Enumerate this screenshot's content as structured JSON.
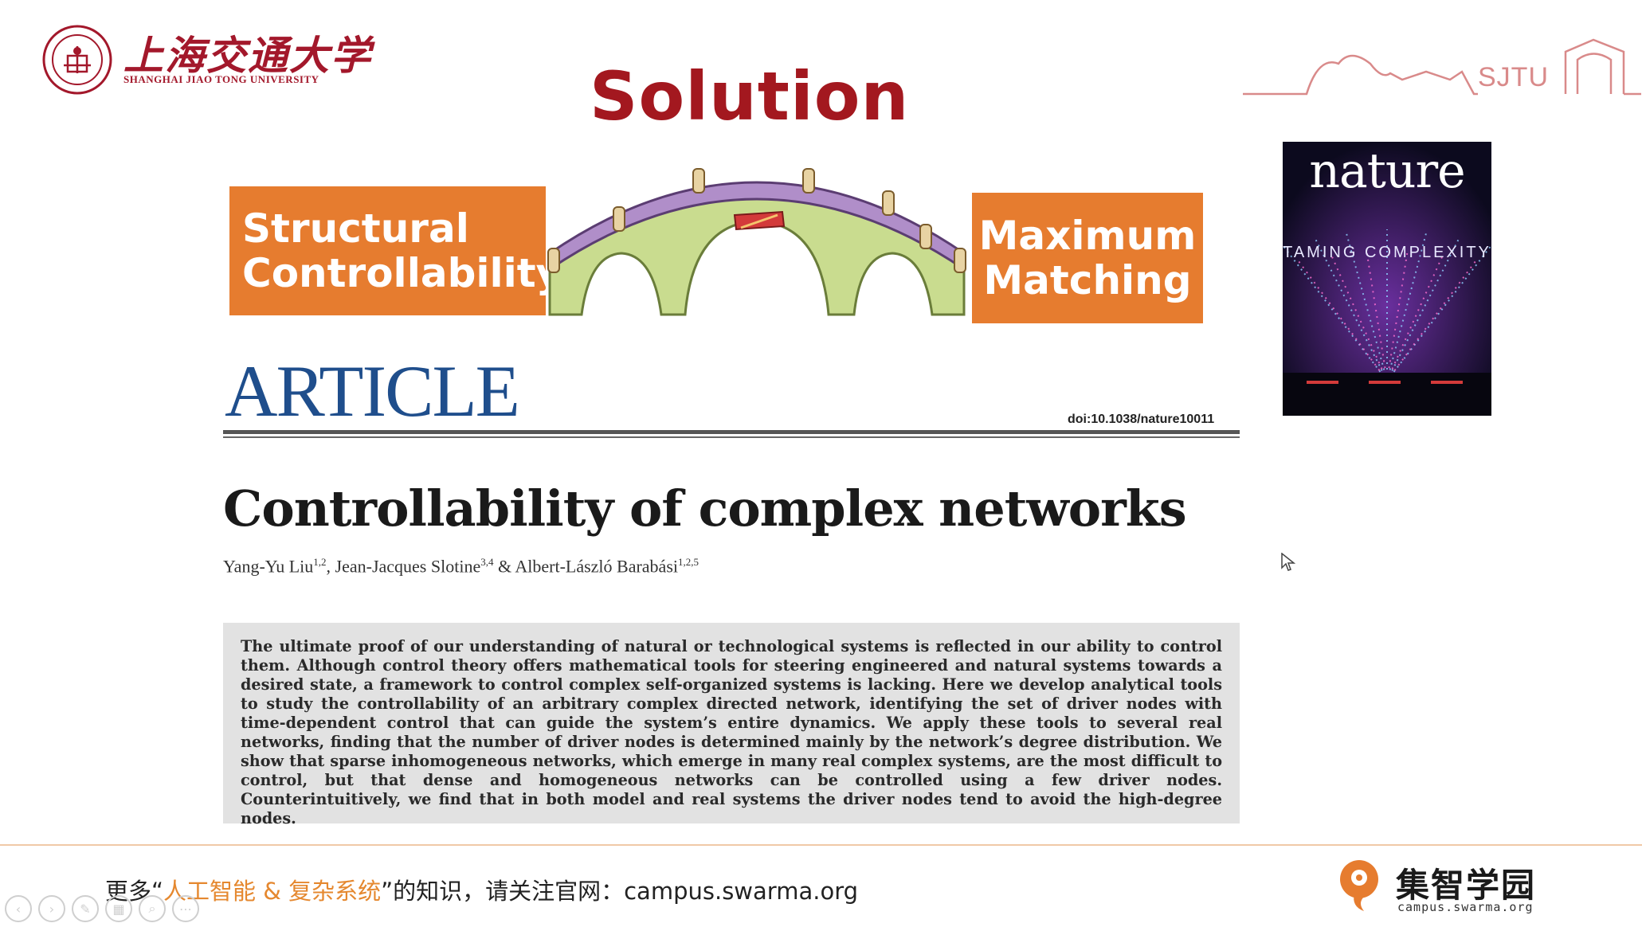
{
  "header": {
    "university_cn": "上海交通大学",
    "university_en": "SHANGHAI JIAO TONG UNIVERSITY",
    "sjtu_mark": "SJTU"
  },
  "slide": {
    "title": "Solution",
    "left_box": [
      "Structural",
      "Controllability"
    ],
    "right_box": [
      "Maximum",
      "Matching"
    ],
    "journal_cover": {
      "title": "nature",
      "subtitle": "TAMING COMPLEXITY"
    },
    "article_label": "ARTICLE",
    "doi": "doi:10.1038/nature10011",
    "paper_title": "Controllability of complex networks",
    "authors": [
      {
        "name": "Yang-Yu Liu",
        "sup": "1,2"
      },
      {
        "name": "Jean-Jacques Slotine",
        "sup": "3,4"
      },
      {
        "name": "Albert-László Barabási",
        "sup": "1,2,5"
      }
    ],
    "abstract": "The ultimate proof of our understanding of natural or technological systems is reflected in our ability to control them. Although control theory offers mathematical tools for steering engineered and natural systems towards a desired state, a framework to control complex self-organized systems is lacking. Here we develop analytical tools to study the controllability of an arbitrary complex directed network, identifying the set of driver nodes with time-dependent control that can guide the system’s entire dynamics. We apply these tools to several real networks, finding that the number of driver nodes is determined mainly by the network’s degree distribution. We show that sparse inhomogeneous networks, which emerge in many real complex systems, are the most difficult to control, but that dense and homogeneous networks can be controlled using a few driver nodes. Counterintuitively, we find that in both model and real systems the driver nodes tend to avoid the high-degree nodes."
  },
  "footer": {
    "text_prefix": "更多“",
    "text_highlight": "人工智能 & 复杂系统",
    "text_suffix": "”的知识，请关注官网：campus.swarma.org",
    "brand_cn": "集智学园",
    "brand_en": "campus.swarma.org"
  },
  "colors": {
    "accent_red": "#a3181f",
    "orange": "#e67c2f",
    "article_blue": "#1f4e8c"
  }
}
